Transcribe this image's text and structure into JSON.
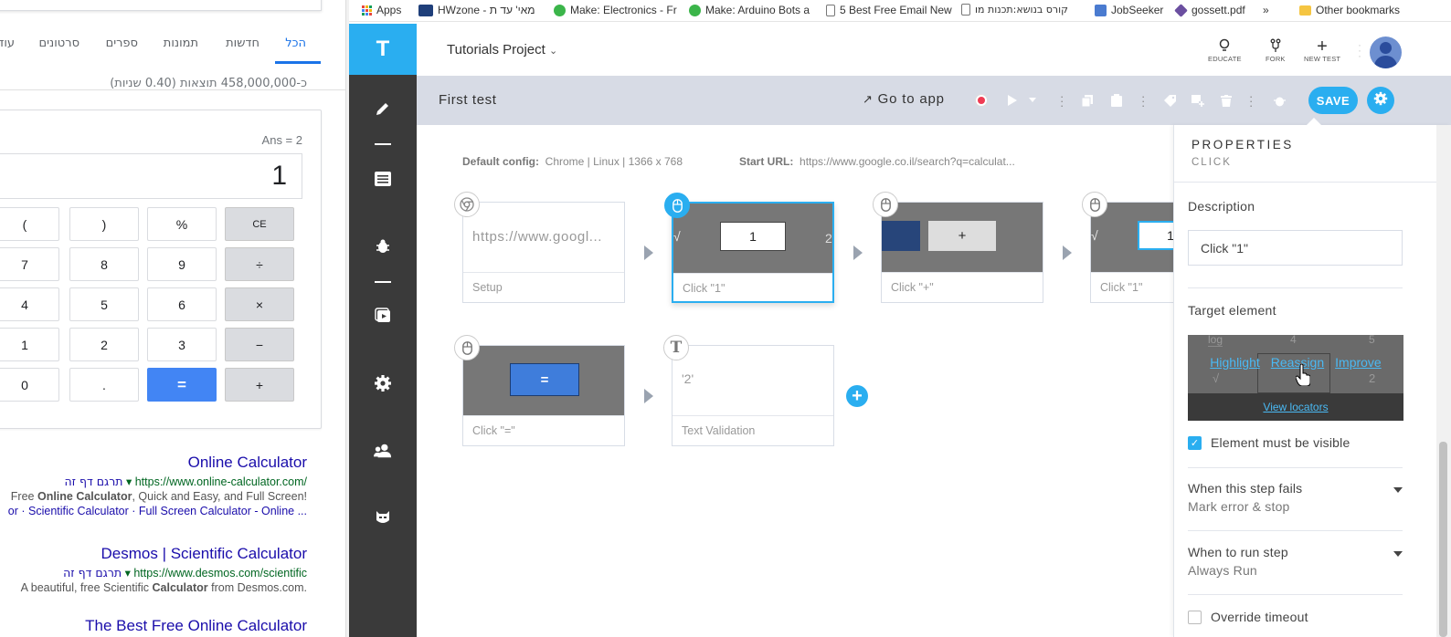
{
  "google": {
    "tabs": [
      {
        "label": "הכל",
        "active": true
      },
      {
        "label": "חדשות"
      },
      {
        "label": "תמונות"
      },
      {
        "label": "ספרים"
      },
      {
        "label": "סרטונים"
      },
      {
        "label": "עוד"
      }
    ],
    "result_count": "כ-458,000,000 תוצאות (0.40 שניות)",
    "calculator": {
      "ans": "Ans = 2",
      "display": "1",
      "keys": [
        [
          "(",
          ")",
          "%",
          "CE"
        ],
        [
          "7",
          "8",
          "9",
          "÷"
        ],
        [
          "4",
          "5",
          "6",
          "×"
        ],
        [
          "1",
          "2",
          "3",
          "−"
        ],
        [
          "0",
          ".",
          "=",
          "+"
        ]
      ]
    },
    "results": [
      {
        "title": "Online Calculator",
        "url": "https://www.online-calculator.com/",
        "translate": "תרגם דף זה",
        "snippet_prefix": "Free ",
        "snippet_bold": "Online Calculator",
        "snippet_suffix": ", Quick and Easy, and Full Screen!",
        "links": "or · Scientific Calculator · Full Screen Calculator - Online ..."
      },
      {
        "title": "Desmos | Scientific Calculator",
        "url": "https://www.desmos.com/scientific",
        "translate": "תרגם דף זה",
        "snippet_prefix": "A beautiful, free Scientific ",
        "snippet_bold": "Calculator",
        "snippet_suffix": " from Desmos.com."
      },
      {
        "title": "The Best Free Online Calculator"
      }
    ]
  },
  "bookmarks": [
    {
      "label": "Apps",
      "color": "#e8453c"
    },
    {
      "label": "HWzone - מאי' עד ת",
      "color": "#1f3f7a"
    },
    {
      "label": "Make: Electronics - Fr",
      "color": "#3bb54a"
    },
    {
      "label": "Make: Arduino Bots a",
      "color": "#3bb54a"
    },
    {
      "label": "5 Best Free Email New",
      "color": "#ffffff"
    },
    {
      "label": "קורס בנושא:תכנות מו",
      "color": "#ffffff"
    },
    {
      "label": "JobSeeker",
      "color": "#4a7bd0"
    },
    {
      "label": "gossett.pdf",
      "color": "#6b4fa0"
    },
    {
      "label": "»",
      "color": ""
    },
    {
      "label": "Other bookmarks",
      "color": "#f5c542"
    }
  ],
  "app": {
    "logo": "T",
    "project": "Tutorials Project",
    "toolbar": {
      "educate": "EDUCATE",
      "fork": "FORK",
      "new_test": "NEW TEST"
    },
    "test_name": "First test",
    "go_to_app": "Go to app",
    "save": "SAVE",
    "config": {
      "default_label": "Default config:",
      "default_value": "Chrome | Linux | 1366 x 768",
      "start_label": "Start URL:",
      "start_value": "https://www.google.co.il/search?q=calculat..."
    },
    "steps": [
      {
        "name": "Setup",
        "preview": "https://www.googl...",
        "type": "setup"
      },
      {
        "name": "Click \"1\"",
        "preview": "1",
        "type": "click",
        "selected": true
      },
      {
        "name": "Click \"+\"",
        "preview": "+",
        "type": "click"
      },
      {
        "name": "Click \"1\"",
        "preview": "1",
        "type": "click"
      },
      {
        "name": "Click \"=\"",
        "preview": "=",
        "type": "click"
      },
      {
        "name": "Text Validation",
        "preview": "'2'",
        "type": "text"
      }
    ],
    "thumb_glyphs": {
      "sqrt": "√",
      "two": "2"
    },
    "properties": {
      "title": "PROPERTIES",
      "subtitle": "CLICK",
      "description_label": "Description",
      "description_value": "Click \"1\"",
      "target_label": "Target element",
      "target_bg_labels": [
        "log",
        "4",
        "5",
        "√",
        "2"
      ],
      "target_links": [
        "Highlight",
        "Reassign",
        "Improve"
      ],
      "view_locators": "View locators",
      "visible_label": "Element must be visible",
      "visible_checked": true,
      "fail_label": "When this step fails",
      "fail_value": "Mark error & stop",
      "run_label": "When to run step",
      "run_value": "Always Run",
      "timeout_label": "Override timeout",
      "timeout_checked": false
    }
  }
}
